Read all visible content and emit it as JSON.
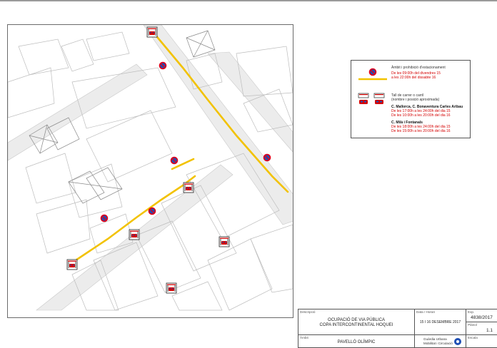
{
  "legend": {
    "no_parking_title": "Àmbit i prohibició d'estacionament",
    "no_parking_line1": "De les 09:00h del divendres 15",
    "no_parking_line2": "a les 22:00h del dissabte 16",
    "closure_title": "Tall de carrer o carril",
    "closure_subtitle": "(nombre i posició aproximada)",
    "group1_streets": "C. Mallorca, C. Bonaventura Carles Aribau",
    "group1_line1": "De les 17:00h a les 24:00h del dia 15",
    "group1_line2": "De les 10:00h a les 20:00h del dia 16",
    "group2_streets": "C. Milà i Fontanals",
    "group2_line1": "De les 18:00h a les 24:00h del dia 15",
    "group2_line2": "De les 15:00h a les 20:00h del dia 16"
  },
  "title_block": {
    "descripcio_label": "Descripció",
    "descripcio_line1": "OCUPACIÓ DE VIA PÚBLICA",
    "descripcio_line2": "COPA INTERCONTINENTAL HOQUEI",
    "data_label": "Data / Horari",
    "data_value": "15 I 16 DESEMBRE 2017",
    "exp_label": "Exp.",
    "exp_value": "4838/2017",
    "planol_label": "Plànol",
    "planol_value": "1.1",
    "ambit_label": "Àmbit",
    "ambit_value": "PAVELLÓ OLÍMPIC",
    "dept_line1": "Guàrdia Urbana",
    "dept_line2": "Mobilitat i Circulació",
    "escala_label": "Escala"
  },
  "colors": {
    "no_parking_line": "#f2c200",
    "no_parking_sign_red": "#e2001a",
    "no_parking_sign_blue": "#1f4fb4",
    "closure_red": "#d40000",
    "legend_red_text": "#d40000",
    "street_grey": "#e6e6e6"
  },
  "icons": [
    "no-parking-sign-icon",
    "road-barrier-icon",
    "police-car-icon"
  ]
}
